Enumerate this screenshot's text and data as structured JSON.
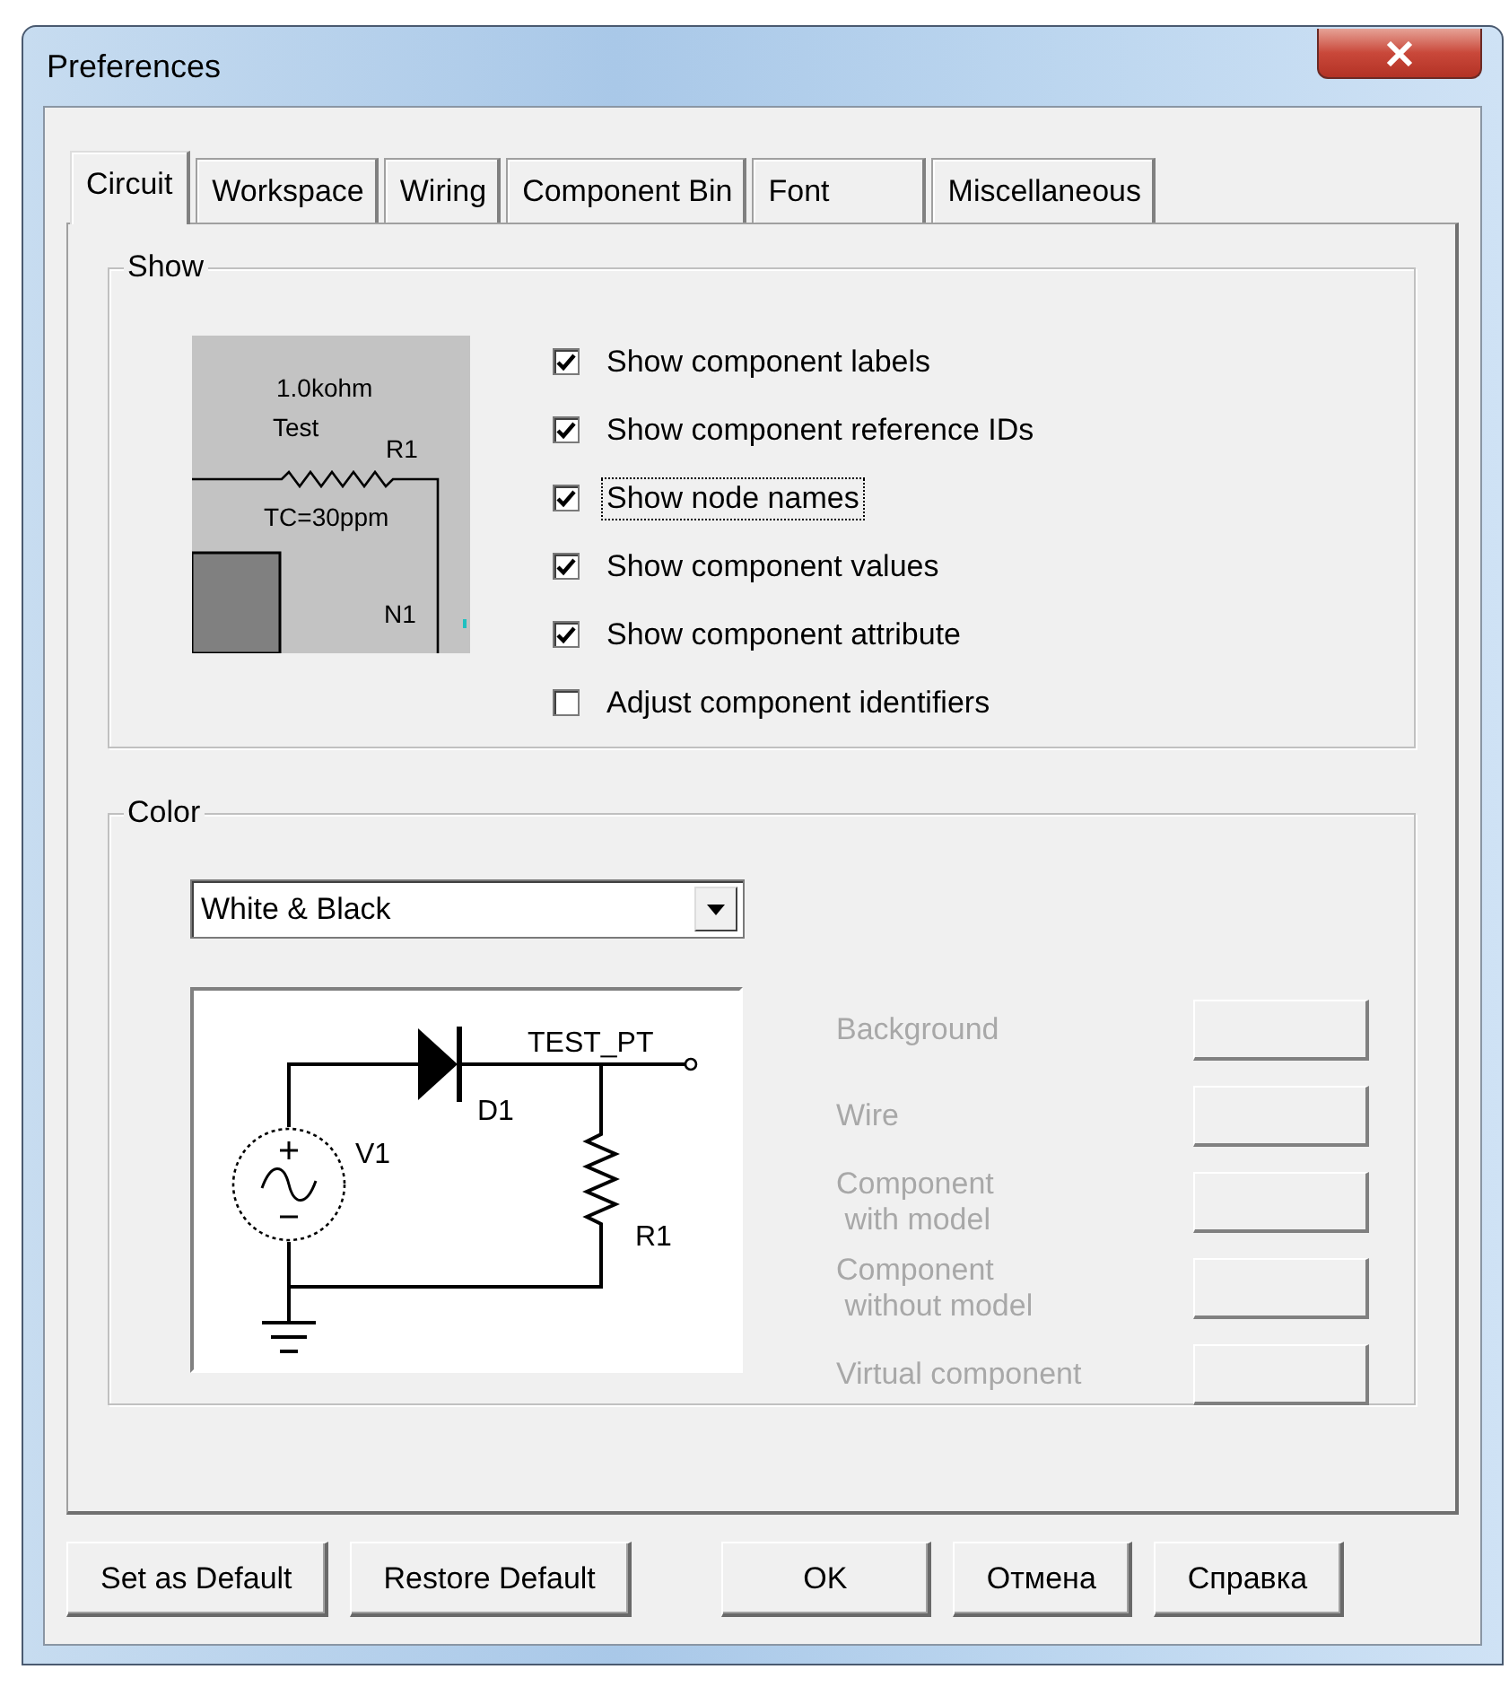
{
  "window": {
    "title": "Preferences"
  },
  "tabs": [
    {
      "label": "Circuit",
      "selected": true
    },
    {
      "label": "Workspace",
      "selected": false
    },
    {
      "label": "Wiring",
      "selected": false
    },
    {
      "label": "Component Bin",
      "selected": false
    },
    {
      "label": "Font",
      "selected": false
    },
    {
      "label": "Miscellaneous",
      "selected": false
    }
  ],
  "show_group": {
    "title": "Show",
    "preview_labels": [
      {
        "kind": "value",
        "text": "1.0kohm"
      },
      {
        "kind": "name",
        "text": "Test"
      },
      {
        "kind": "refdes",
        "text": "R1"
      },
      {
        "kind": "attribute",
        "text": "TC=30ppm"
      },
      {
        "kind": "node",
        "text": "N1"
      }
    ],
    "options": [
      {
        "label": "Show component labels",
        "checked": true,
        "focused": false
      },
      {
        "label": "Show component reference IDs",
        "checked": true,
        "focused": false
      },
      {
        "label": "Show node names",
        "checked": true,
        "focused": true
      },
      {
        "label": "Show component values",
        "checked": true,
        "focused": false
      },
      {
        "label": "Show component attribute",
        "checked": true,
        "focused": false
      },
      {
        "label": "Adjust component identifiers",
        "checked": false,
        "focused": false
      }
    ]
  },
  "color_group": {
    "title": "Color",
    "scheme": {
      "value": "White & Black"
    },
    "preview_labels": [
      {
        "kind": "testpoint",
        "text": "TEST_PT"
      },
      {
        "kind": "diode",
        "text": "D1"
      },
      {
        "kind": "source",
        "text": "V1"
      },
      {
        "kind": "resistor",
        "text": "R1"
      }
    ],
    "color_rows": [
      {
        "label": "Background",
        "disabled": true
      },
      {
        "label": "Wire",
        "disabled": true
      },
      {
        "label": "Component\n with model",
        "disabled": true
      },
      {
        "label": "Component\n without model",
        "disabled": true
      },
      {
        "label": "Virtual component",
        "disabled": true
      }
    ]
  },
  "buttons": [
    {
      "label": "Set as Default",
      "kind": "left"
    },
    {
      "label": "Restore Default",
      "kind": "left"
    },
    {
      "label": "OK",
      "kind": "right"
    },
    {
      "label": "Отмена",
      "kind": "right"
    },
    {
      "label": "Справка",
      "kind": "right"
    }
  ]
}
